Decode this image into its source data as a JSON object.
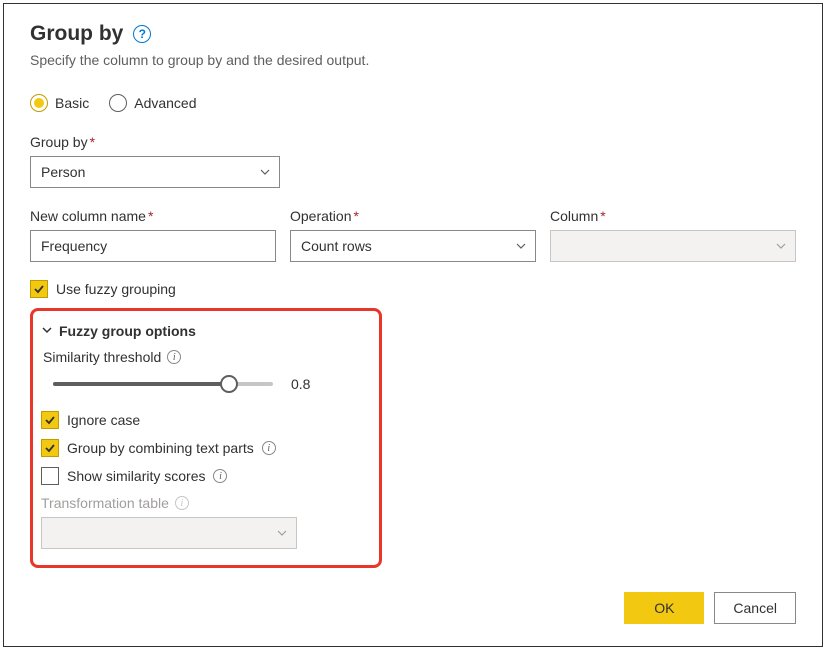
{
  "dialog": {
    "title": "Group by",
    "description": "Specify the column to group by and the desired output."
  },
  "mode": {
    "basic": "Basic",
    "advanced": "Advanced"
  },
  "groupBy": {
    "label": "Group by",
    "value": "Person"
  },
  "newColumn": {
    "label": "New column name",
    "value": "Frequency"
  },
  "operation": {
    "label": "Operation",
    "value": "Count rows"
  },
  "column": {
    "label": "Column",
    "value": ""
  },
  "fuzzy": {
    "useLabel": "Use fuzzy grouping",
    "optionsTitle": "Fuzzy group options",
    "similarityLabel": "Similarity threshold",
    "similarityValue": "0.8",
    "ignoreCase": "Ignore case",
    "combineTextParts": "Group by combining text parts",
    "showScores": "Show similarity scores",
    "transformTableLabel": "Transformation table"
  },
  "buttons": {
    "ok": "OK",
    "cancel": "Cancel"
  }
}
